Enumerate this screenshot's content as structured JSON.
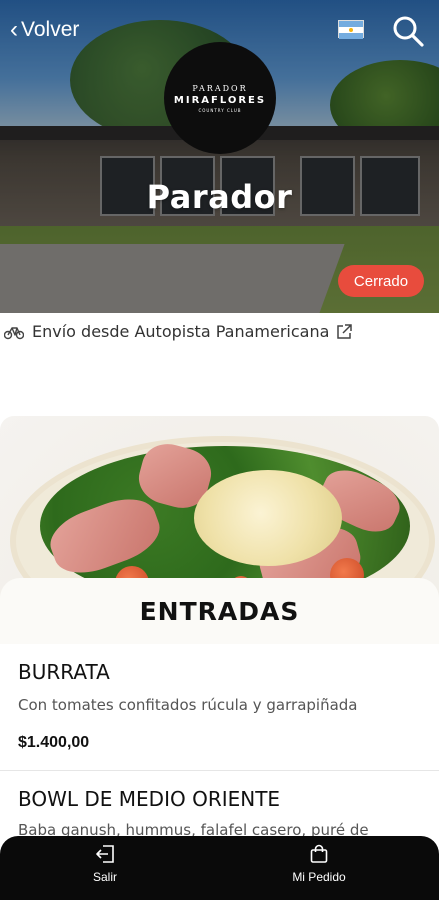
{
  "header": {
    "back_label": "Volver",
    "flag_country": "Argentina",
    "search_icon": "search-icon"
  },
  "logo": {
    "line1": "PARADOR",
    "line2": "MIRAFLORES",
    "line3": "COUNTRY CLUB"
  },
  "hero": {
    "title": "Parador",
    "status": "Cerrado",
    "status_color": "#e84c3d"
  },
  "delivery": {
    "icon": "bicycle-icon",
    "text": "Envío desde Autopista Panamericana",
    "link_icon": "external-link-icon"
  },
  "category": {
    "title": "ENTRADAS"
  },
  "items": [
    {
      "name": "BURRATA",
      "description": "Con tomates confitados rúcula y garrapiñada",
      "price": "$1.400,00"
    },
    {
      "name": "BOWL DE MEDIO ORIENTE",
      "description": "Baba ganush, hummus, falafel casero, puré de"
    }
  ],
  "bottom_nav": {
    "exit_label": "Salir",
    "exit_icon": "logout-icon",
    "order_label": "Mi Pedido",
    "order_icon": "shopping-bag-icon",
    "background": "#0a0a0a"
  }
}
